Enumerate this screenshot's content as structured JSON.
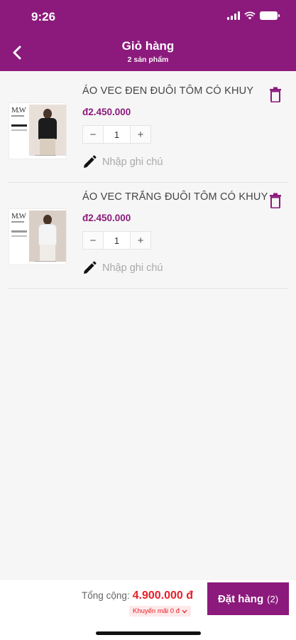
{
  "status_bar": {
    "time": "9:26"
  },
  "header": {
    "title": "Giỏ hàng",
    "subtitle": "2 sản phẩm"
  },
  "items": [
    {
      "name": "ÁO VEC ĐEN ĐUÔI TÔM CÓ KHUY",
      "price": "đ2.450.000",
      "quantity": "1",
      "minus": "−",
      "plus": "+",
      "note_placeholder": "Nhập ghi chú",
      "thumb_brand": "M.W",
      "thumb_color": "black"
    },
    {
      "name": "ÁO VEC TRẮNG ĐUÔI TÔM CÓ KHUY",
      "price": "đ2.450.000",
      "quantity": "1",
      "minus": "−",
      "plus": "+",
      "note_placeholder": "Nhập ghi chú",
      "thumb_brand": "M.W",
      "thumb_color": "white"
    }
  ],
  "footer": {
    "total_label": "Tổng cộng:",
    "total_value": "4.900.000 đ",
    "promo_text": "Khuyến mãi 0 đ",
    "order_label": "Đặt hàng",
    "order_count": "(2)"
  },
  "colors": {
    "brand": "#8c1a7c",
    "price_red": "#e8202a",
    "background": "#f6f6f6"
  },
  "icons": {
    "back": "chevron-left-icon",
    "delete": "trash-icon",
    "note": "pencil-icon",
    "promo": "chevron-down-icon"
  }
}
